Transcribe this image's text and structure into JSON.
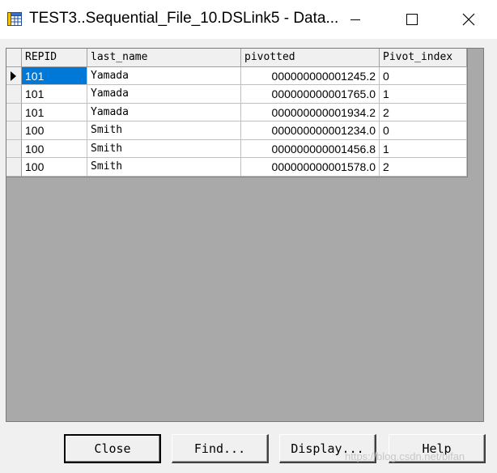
{
  "window": {
    "title": "TEST3..Sequential_File_10.DSLink5 - Data..."
  },
  "grid": {
    "columns": [
      "REPID",
      "last_name",
      "pivotted",
      "Pivot_index"
    ],
    "rows": [
      [
        "101",
        "Yamada",
        "000000000001245.2",
        "0"
      ],
      [
        "101",
        "Yamada",
        "000000000001765.0",
        "1"
      ],
      [
        "101",
        "Yamada",
        "000000000001934.2",
        "2"
      ],
      [
        "100",
        "Smith",
        "000000000001234.0",
        "0"
      ],
      [
        "100",
        "Smith",
        "000000000001456.8",
        "1"
      ],
      [
        "100",
        "Smith",
        "000000000001578.0",
        "2"
      ]
    ],
    "selected_row": 0
  },
  "buttons": {
    "close": "Close",
    "find": "Find...",
    "display": "Display...",
    "help": "Help"
  },
  "watermark": "https://blog.csdn.net/bifan",
  "colors": {
    "selection": "#0078d7",
    "grid_background": "#a9a9a9"
  }
}
